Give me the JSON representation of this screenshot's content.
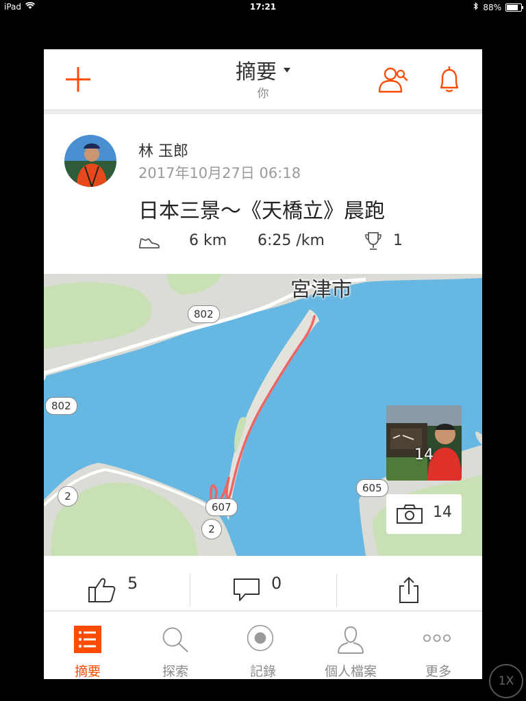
{
  "status_bar": {
    "device": "iPad",
    "time": "17:21",
    "battery": "88%",
    "battery_level": 0.88
  },
  "header": {
    "title": "摘要",
    "subtitle": "你"
  },
  "activity": {
    "athlete_name": "林 玉郎",
    "date": "2017年10月27日 06:18",
    "title": "日本三景～《天橋立》晨跑",
    "distance": "6 km",
    "pace": "6:25 /km",
    "achievements": "1"
  },
  "map": {
    "city_label": "宮津市",
    "road_labels": {
      "r802_top": "802",
      "r802_left": "802",
      "r2_left": "2",
      "r607": "607",
      "r2_bottom": "2",
      "r605": "605"
    },
    "photo_thumb_count": "14",
    "photo_count": "14",
    "route_color": "#f06464",
    "water_color": "#67b7e3",
    "land_color": "#dcdcd6"
  },
  "actions": {
    "kudos": "5",
    "comments": "0"
  },
  "tabs": [
    {
      "label": "摘要",
      "icon": "feed-list-icon",
      "active": true
    },
    {
      "label": "探索",
      "icon": "search-icon",
      "active": false
    },
    {
      "label": "記錄",
      "icon": "record-icon",
      "active": false
    },
    {
      "label": "個人檔案",
      "icon": "profile-icon",
      "active": false
    },
    {
      "label": "更多",
      "icon": "more-icon",
      "active": false
    }
  ],
  "zoom_button": "1X",
  "accent_color": "#fc4c02"
}
